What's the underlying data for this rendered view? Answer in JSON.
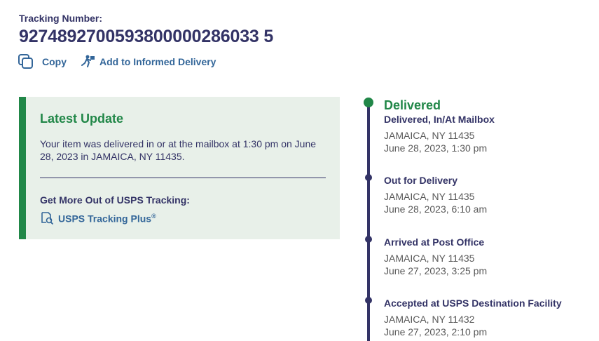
{
  "tracking": {
    "label": "Tracking Number:",
    "number": "9274892700593800000286033 5"
  },
  "actions": {
    "copy_label": "Copy",
    "informed_label": "Add to Informed Delivery"
  },
  "latest_update": {
    "title": "Latest Update",
    "text": "Your item was delivered in or at the mailbox at 1:30 pm on June 28, 2023 in JAMAICA, NY 11435.",
    "more_label": "Get More Out of USPS Tracking:",
    "plus_label": "USPS Tracking Plus",
    "plus_mark": "®"
  },
  "events": [
    {
      "status": "Delivered",
      "title": "Delivered, In/At Mailbox",
      "location": "JAMAICA, NY 11435",
      "time": "June 28, 2023, 1:30 pm"
    },
    {
      "title": "Out for Delivery",
      "location": "JAMAICA, NY 11435",
      "time": "June 28, 2023, 6:10 am"
    },
    {
      "title": "Arrived at Post Office",
      "location": "JAMAICA, NY 11435",
      "time": "June 27, 2023, 3:25 pm"
    },
    {
      "title": "Accepted at USPS Destination Facility",
      "location": "JAMAICA, NY 11432",
      "time": "June 27, 2023, 2:10 pm"
    }
  ],
  "colors": {
    "navy": "#333366",
    "green": "#218748",
    "link": "#336699",
    "card_bg": "#e8f0e9"
  },
  "icons": {
    "copy": "copy-icon",
    "informed": "runner-mail-icon",
    "plus": "tracking-plus-icon"
  }
}
